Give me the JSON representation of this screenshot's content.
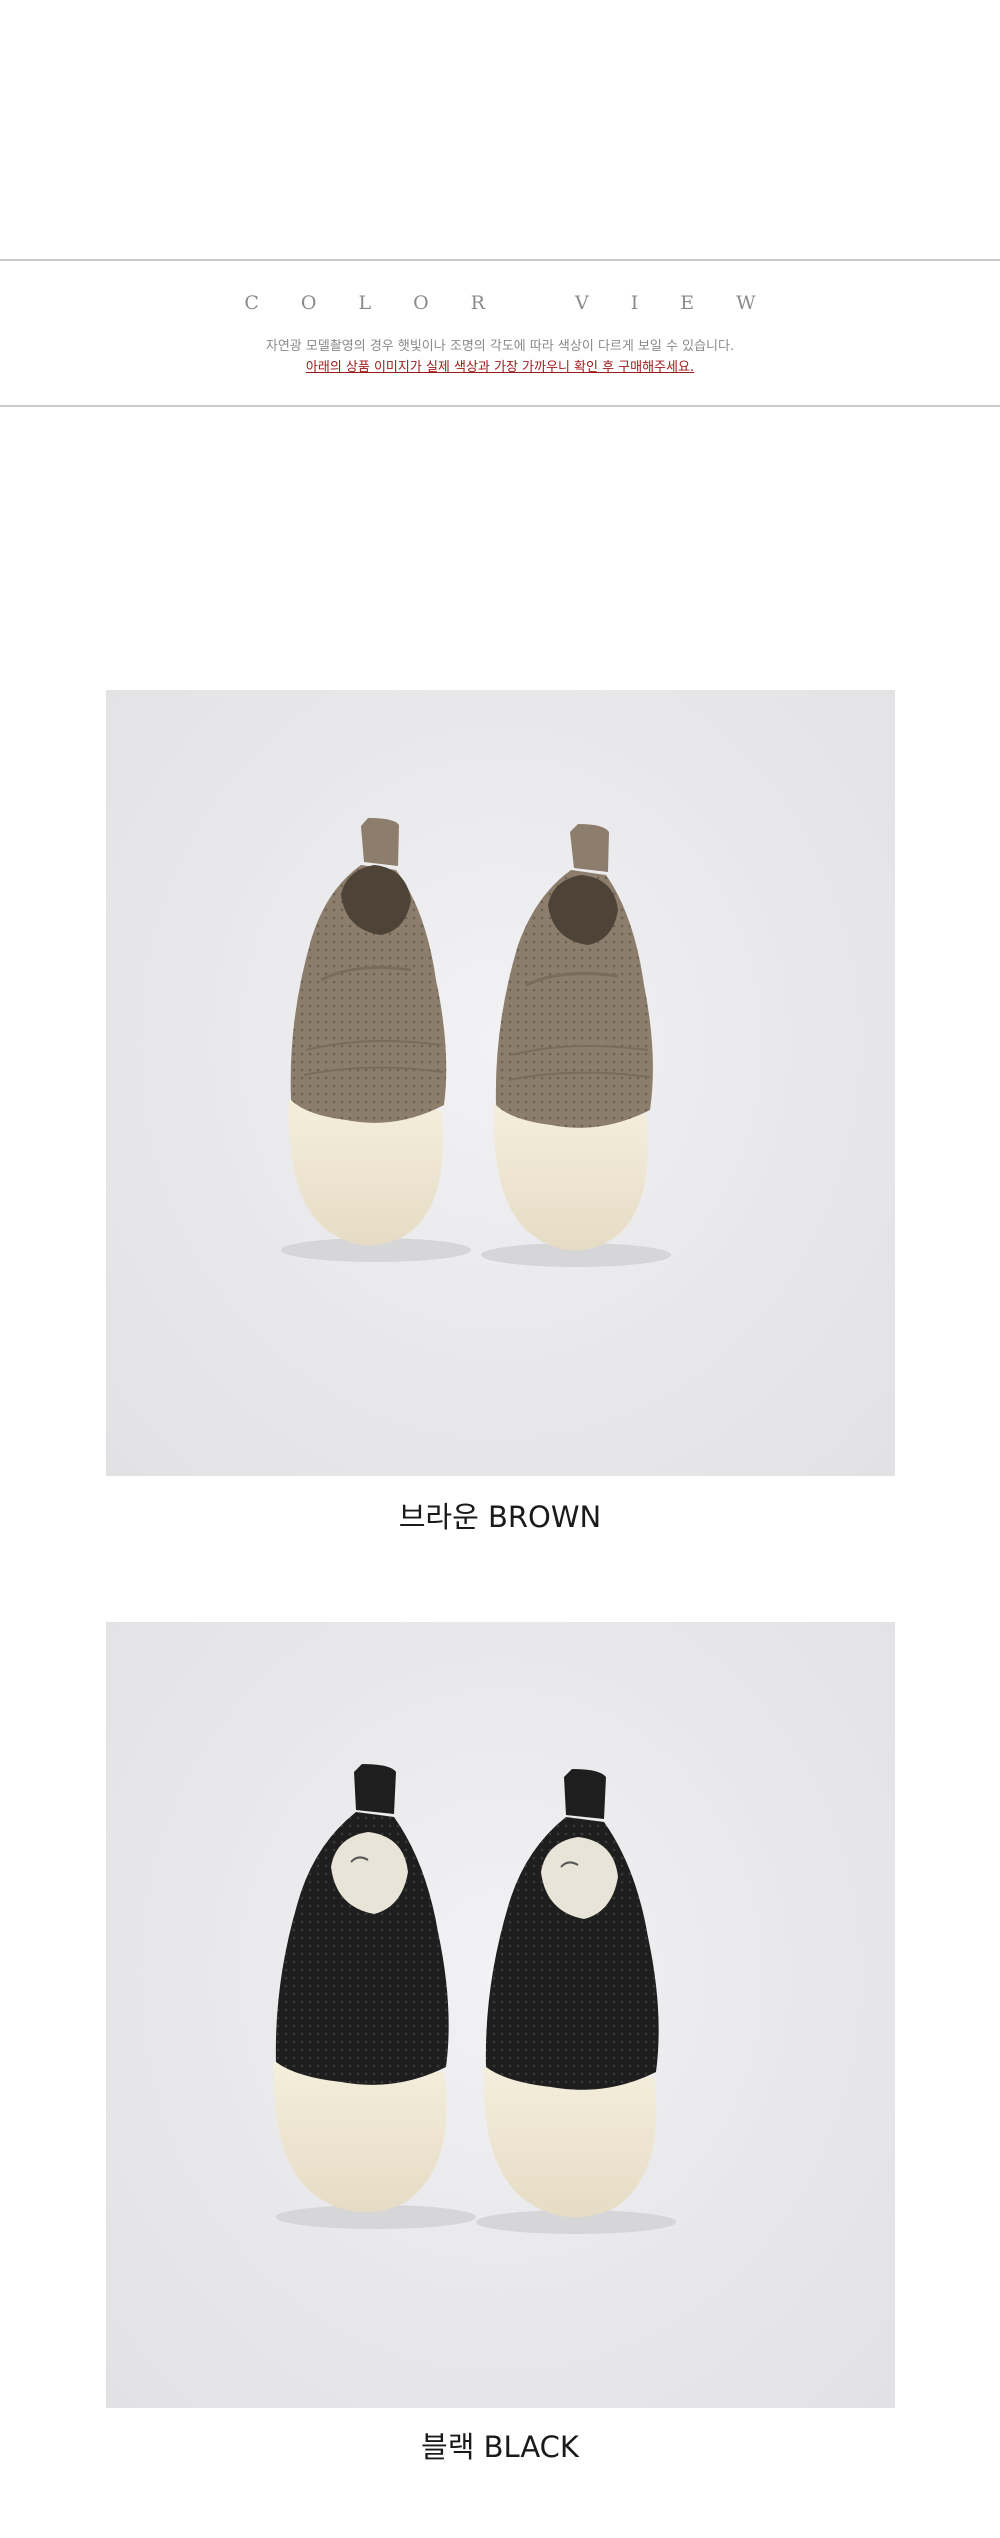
{
  "header": {
    "title": "COLOR VIEW",
    "notice_line1": "자연광 모델촬영의 경우 햇빛이나 조명의 각도에 따라 색상이 다르게 보일 수 있습니다.",
    "notice_line2": "아래의 상품 이미지가 실제 색상과 가장 가까우니 확인 후 구매해주세요."
  },
  "colors": [
    {
      "caption": "브라운 BROWN",
      "upper": "#8c7d6c",
      "icon": "brown-slip-on-shoes-image"
    },
    {
      "caption": "블랙 BLACK",
      "upper": "#1e1e1e",
      "icon": "black-slip-on-shoes-image"
    }
  ],
  "palette": {
    "rule": "#c9c9c9",
    "title_text": "#8a8a8a",
    "notice_accent": "#a11a1a",
    "sole": "#f1ead8"
  }
}
